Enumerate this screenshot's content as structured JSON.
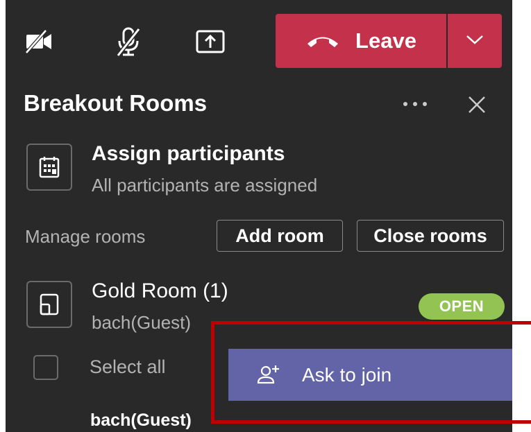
{
  "toolbar": {
    "camera_icon": "camera-off-icon",
    "mic_icon": "mic-off-icon",
    "share_icon": "share-screen-icon",
    "leave_label": "Leave",
    "leave_color": "#c4314b"
  },
  "panel": {
    "title": "Breakout Rooms",
    "more_icon": "more-icon",
    "close_icon": "close-icon"
  },
  "assign": {
    "title": "Assign participants",
    "subtitle": "All participants are assigned"
  },
  "manage": {
    "label": "Manage rooms",
    "add_room": "Add room",
    "close_rooms": "Close rooms"
  },
  "room": {
    "name": "Gold Room (1)",
    "subtitle": "bach(Guest)",
    "status": "OPEN",
    "status_color": "#92c353"
  },
  "members": {
    "select_all": "Select all",
    "items": [
      "bach(Guest)"
    ]
  },
  "context_menu": {
    "ask_to_join": "Ask to join",
    "color": "#6264a7"
  },
  "highlight_color": "#c00000"
}
